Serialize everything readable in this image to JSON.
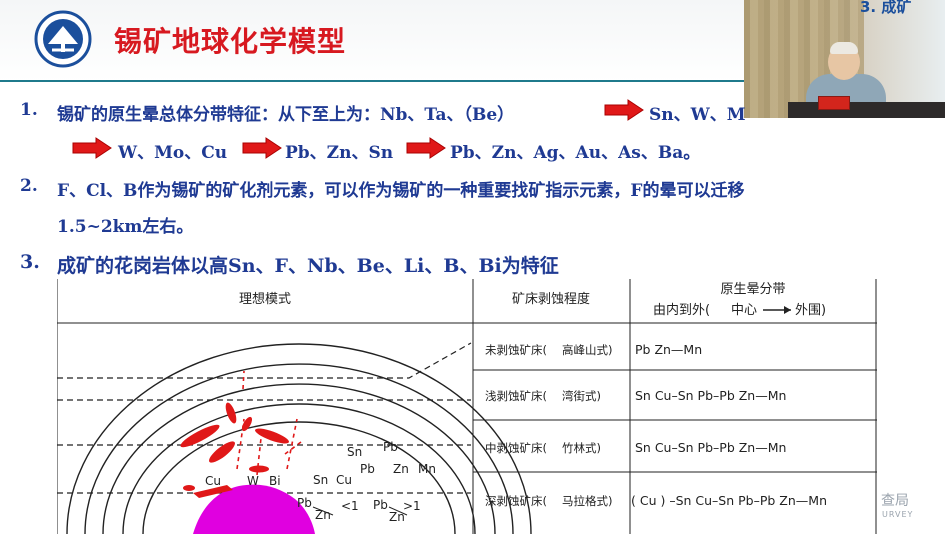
{
  "slide": {
    "title": "锡矿地球化学模型",
    "video_overlay_text": "3. 成矿"
  },
  "points": {
    "p1": {
      "num": "1.",
      "lead": "锡矿的原生晕总体分带特征：从下至上为：Nb、Ta、（Be）",
      "after_arrow_1": "Sn、W、M",
      "line2_a": "W、Mo、Cu",
      "line2_b": "Pb、Zn、Sn",
      "line2_c": "Pb、Zn、Ag、Au、As、Ba。"
    },
    "p2": {
      "num": "2.",
      "line1": "F、Cl、B作为锡矿的矿化剂元素，可以作为锡矿的一种重要找矿指示元素，F的晕可以迁移",
      "line2": "1.5~2km左右。"
    },
    "p3": {
      "num": "3.",
      "text": "成矿的花岗岩体以高Sn、F、Nb、Be、Li、B、Bi为特征"
    }
  },
  "figure": {
    "headers": {
      "ideal_model": "理想模式",
      "erosion": "矿床剥蚀程度",
      "zoning_title": "原生晕分带",
      "zoning_sub_a": "由内到外(",
      "zoning_sub_center": "中心",
      "zoning_sub_b": "外围)"
    },
    "rows": [
      {
        "erosion": "未剥蚀矿床(",
        "example": "高峰山式)",
        "zoning": "Pb Zn—Mn"
      },
      {
        "erosion": "浅剥蚀矿床(",
        "example": "湾街式)",
        "zoning": "Sn Cu–Sn Pb–Pb Zn—Mn"
      },
      {
        "erosion": "中剥蚀矿床(",
        "example": "竹林式)",
        "zoning": "Sn Cu–Sn Pb–Pb Zn—Mn"
      },
      {
        "erosion": "深剥蚀矿床(",
        "example": "马拉格式)",
        "zoning": "( Cu ) –Sn Cu–Sn Pb–Pb Zn—Mn"
      }
    ],
    "model_labels": {
      "cu": "Cu",
      "w": "W",
      "bi": "Bi",
      "sn_a": "Sn",
      "cu_b": "Cu",
      "sn_b": "Sn",
      "pb_a": "Pb",
      "pb_b": "Pb",
      "zn_a": "Zn",
      "mn": "Mn",
      "pb_c": "Pb",
      "zn_b": "Zn",
      "lt_1": "<1",
      "pb_d": "Pb",
      "zn_c": "Zn",
      "gt_1": ">1"
    },
    "colors": {
      "granite": "#e000e0",
      "ore": "#e01818"
    }
  },
  "watermark": {
    "text": "查局",
    "sub": "URVEY"
  },
  "colors": {
    "title": "#d71920",
    "body_text": "#1f3a93",
    "arrow": "#e01818",
    "rule": "#1f7a8c"
  }
}
